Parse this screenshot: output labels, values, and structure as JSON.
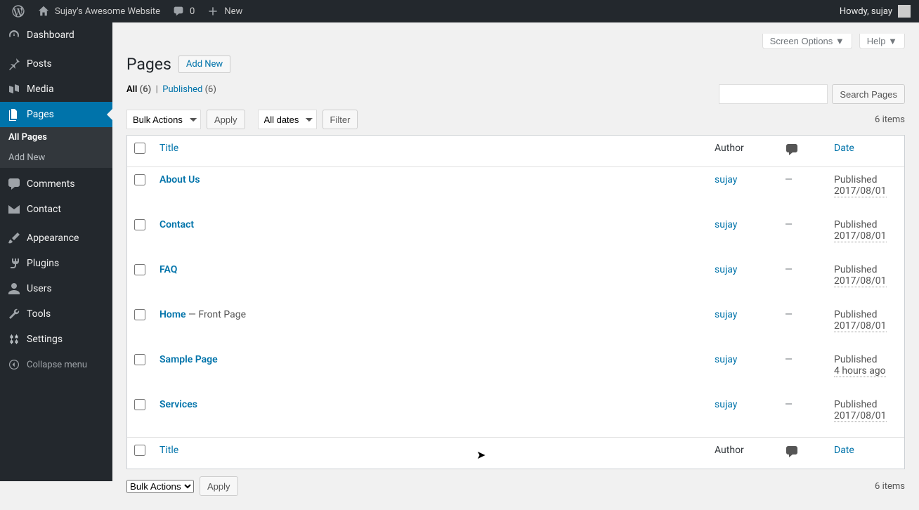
{
  "adminbar": {
    "site_name": "Sujay's Awesome Website",
    "comments_count": "0",
    "new_label": "New",
    "howdy": "Howdy, sujay"
  },
  "sidebar": {
    "items": [
      {
        "name": "dashboard",
        "label": "Dashboard",
        "icon": "dashboard"
      },
      {
        "name": "posts",
        "label": "Posts",
        "icon": "pin"
      },
      {
        "name": "media",
        "label": "Media",
        "icon": "media"
      },
      {
        "name": "pages",
        "label": "Pages",
        "icon": "pages",
        "current": true
      },
      {
        "name": "comments",
        "label": "Comments",
        "icon": "comment"
      },
      {
        "name": "contact",
        "label": "Contact",
        "icon": "mail"
      },
      {
        "name": "appearance",
        "label": "Appearance",
        "icon": "brush"
      },
      {
        "name": "plugins",
        "label": "Plugins",
        "icon": "plug"
      },
      {
        "name": "users",
        "label": "Users",
        "icon": "user"
      },
      {
        "name": "tools",
        "label": "Tools",
        "icon": "wrench"
      },
      {
        "name": "settings",
        "label": "Settings",
        "icon": "settings"
      }
    ],
    "submenu": [
      {
        "label": "All Pages",
        "current": true
      },
      {
        "label": "Add New",
        "current": false
      }
    ],
    "collapse": "Collapse menu"
  },
  "topbuttons": {
    "screen_options": "Screen Options",
    "help": "Help"
  },
  "page": {
    "title": "Pages",
    "add_new": "Add New"
  },
  "filters": {
    "all_label": "All",
    "all_count": "(6)",
    "sep": "|",
    "published_label": "Published",
    "published_count": "(6)"
  },
  "search": {
    "button": "Search Pages"
  },
  "bulk": {
    "action": "Bulk Actions",
    "apply": "Apply",
    "dates": "All dates",
    "filter": "Filter"
  },
  "count_text": "6 items",
  "columns": {
    "title": "Title",
    "author": "Author",
    "date": "Date"
  },
  "rows": [
    {
      "title": "About Us",
      "suffix": "",
      "author": "sujay",
      "comments": "—",
      "status": "Published",
      "date": "2017/08/01"
    },
    {
      "title": "Contact",
      "suffix": "",
      "author": "sujay",
      "comments": "—",
      "status": "Published",
      "date": "2017/08/01"
    },
    {
      "title": "FAQ",
      "suffix": "",
      "author": "sujay",
      "comments": "—",
      "status": "Published",
      "date": "2017/08/01"
    },
    {
      "title": "Home",
      "suffix": " — Front Page",
      "author": "sujay",
      "comments": "—",
      "status": "Published",
      "date": "2017/08/01"
    },
    {
      "title": "Sample Page",
      "suffix": "",
      "author": "sujay",
      "comments": "—",
      "status": "Published",
      "date": "4 hours ago"
    },
    {
      "title": "Services",
      "suffix": "",
      "author": "sujay",
      "comments": "—",
      "status": "Published",
      "date": "2017/08/01"
    }
  ]
}
